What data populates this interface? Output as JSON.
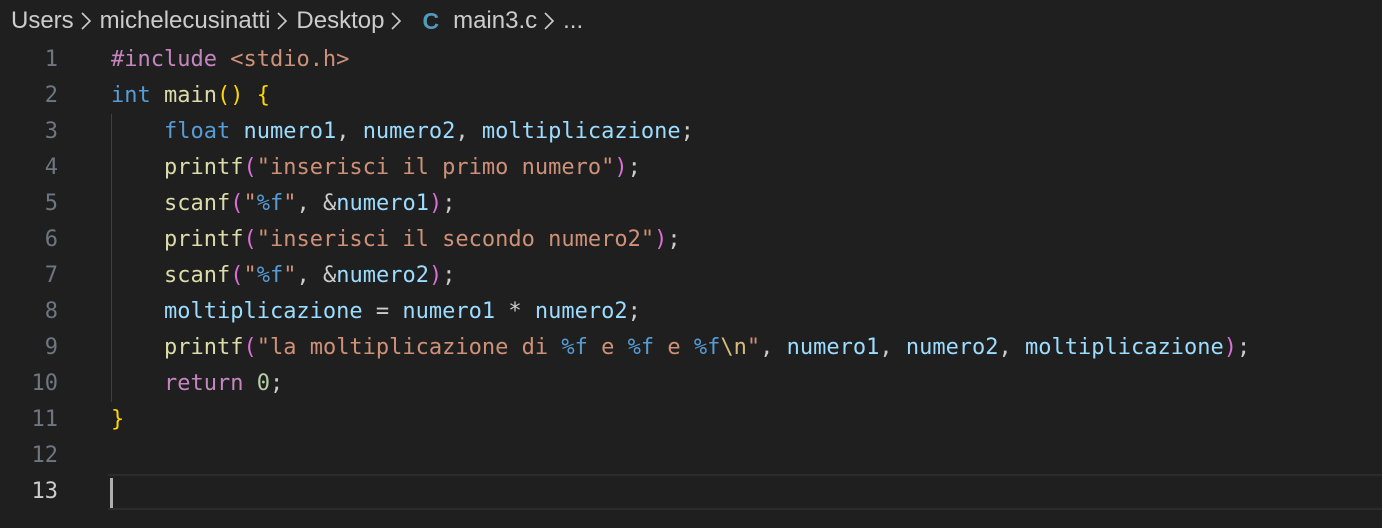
{
  "breadcrumb": {
    "items": [
      "Users",
      "michelecusinatti",
      "Desktop"
    ],
    "file_icon": "C",
    "file_name": "main3.c",
    "ellipsis": "..."
  },
  "colors": {
    "background": "#1f1f1f",
    "keyword": "#569cd6",
    "preprocessor": "#c586c0",
    "function": "#dcdcaa",
    "variable": "#9cdcfe",
    "string": "#ce9178",
    "number": "#b5cea8",
    "bracket_level1": "#ffd700",
    "bracket_level2": "#da70d6",
    "line_number": "#6e7681",
    "active_line_number": "#cccccc"
  },
  "editor": {
    "active_line": 13,
    "lines": [
      {
        "number": "1",
        "tokens": [
          [
            "kw-pp",
            "#include"
          ],
          [
            "punct",
            " "
          ],
          [
            "inc",
            "<stdio.h>"
          ]
        ]
      },
      {
        "number": "2",
        "tokens": [
          [
            "type",
            "int"
          ],
          [
            "punct",
            " "
          ],
          [
            "fn",
            "main"
          ],
          [
            "brace",
            "()"
          ],
          [
            "punct",
            " "
          ],
          [
            "brace",
            "{"
          ]
        ]
      },
      {
        "number": "3",
        "tokens": [
          [
            "punct",
            "    "
          ],
          [
            "type",
            "float"
          ],
          [
            "punct",
            " "
          ],
          [
            "var",
            "numero1"
          ],
          [
            "punct",
            ", "
          ],
          [
            "var",
            "numero2"
          ],
          [
            "punct",
            ", "
          ],
          [
            "var",
            "moltiplicazione"
          ],
          [
            "punct",
            ";"
          ]
        ]
      },
      {
        "number": "4",
        "tokens": [
          [
            "punct",
            "    "
          ],
          [
            "fn",
            "printf"
          ],
          [
            "paren",
            "("
          ],
          [
            "str",
            "\"inserisci il primo numero\""
          ],
          [
            "paren",
            ")"
          ],
          [
            "punct",
            ";"
          ]
        ]
      },
      {
        "number": "5",
        "tokens": [
          [
            "punct",
            "    "
          ],
          [
            "fn",
            "scanf"
          ],
          [
            "paren",
            "("
          ],
          [
            "str",
            "\""
          ],
          [
            "fmt",
            "%f"
          ],
          [
            "str",
            "\""
          ],
          [
            "punct",
            ", &"
          ],
          [
            "var",
            "numero1"
          ],
          [
            "paren",
            ")"
          ],
          [
            "punct",
            ";"
          ]
        ]
      },
      {
        "number": "6",
        "tokens": [
          [
            "punct",
            "    "
          ],
          [
            "fn",
            "printf"
          ],
          [
            "paren",
            "("
          ],
          [
            "str",
            "\"inserisci il secondo numero2\""
          ],
          [
            "paren",
            ")"
          ],
          [
            "punct",
            ";"
          ]
        ]
      },
      {
        "number": "7",
        "tokens": [
          [
            "punct",
            "    "
          ],
          [
            "fn",
            "scanf"
          ],
          [
            "paren",
            "("
          ],
          [
            "str",
            "\""
          ],
          [
            "fmt",
            "%f"
          ],
          [
            "str",
            "\""
          ],
          [
            "punct",
            ", &"
          ],
          [
            "var",
            "numero2"
          ],
          [
            "paren",
            ")"
          ],
          [
            "punct",
            ";"
          ]
        ]
      },
      {
        "number": "8",
        "tokens": [
          [
            "punct",
            "    "
          ],
          [
            "var",
            "moltiplicazione"
          ],
          [
            "punct",
            " = "
          ],
          [
            "var",
            "numero1"
          ],
          [
            "punct",
            " * "
          ],
          [
            "var",
            "numero2"
          ],
          [
            "punct",
            ";"
          ]
        ]
      },
      {
        "number": "9",
        "tokens": [
          [
            "punct",
            "    "
          ],
          [
            "fn",
            "printf"
          ],
          [
            "paren",
            "("
          ],
          [
            "str",
            "\"la moltiplicazione di "
          ],
          [
            "fmt",
            "%f"
          ],
          [
            "str",
            " e "
          ],
          [
            "fmt",
            "%f"
          ],
          [
            "str",
            " e "
          ],
          [
            "fmt",
            "%f"
          ],
          [
            "esc",
            "\\n"
          ],
          [
            "str",
            "\""
          ],
          [
            "punct",
            ", "
          ],
          [
            "var",
            "numero1"
          ],
          [
            "punct",
            ", "
          ],
          [
            "var",
            "numero2"
          ],
          [
            "punct",
            ", "
          ],
          [
            "var",
            "moltiplicazione"
          ],
          [
            "paren",
            ")"
          ],
          [
            "punct",
            ";"
          ]
        ]
      },
      {
        "number": "10",
        "tokens": [
          [
            "punct",
            "    "
          ],
          [
            "ctrl",
            "return"
          ],
          [
            "punct",
            " "
          ],
          [
            "num",
            "0"
          ],
          [
            "punct",
            ";"
          ]
        ]
      },
      {
        "number": "11",
        "tokens": [
          [
            "brace",
            "}"
          ]
        ]
      },
      {
        "number": "12",
        "tokens": []
      },
      {
        "number": "13",
        "tokens": []
      }
    ]
  }
}
